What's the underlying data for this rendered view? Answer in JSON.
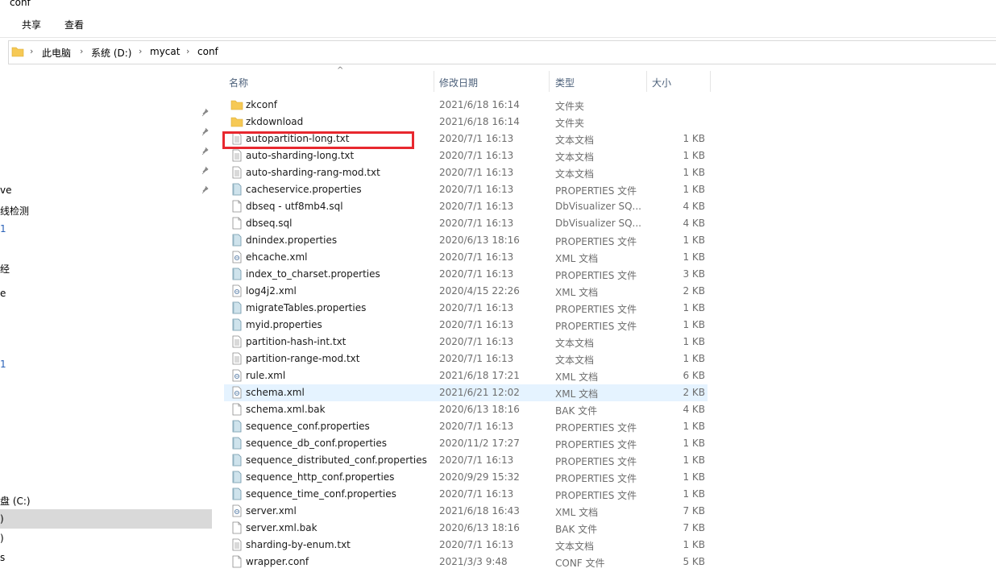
{
  "window": {
    "title": "conf"
  },
  "ribbon": {
    "tabs": [
      "共享",
      "查看"
    ]
  },
  "address": {
    "crumbs": [
      "此电脑",
      "系统 (D:)",
      "mycat",
      "conf"
    ]
  },
  "nav": {
    "items": [
      "ve",
      "线检测",
      "1",
      "经",
      "e",
      "1",
      "盘 (C:)",
      ")",
      ")",
      "s"
    ]
  },
  "columns": {
    "name": "名称",
    "date": "修改日期",
    "type": "类型",
    "size": "大小"
  },
  "files": [
    {
      "name": "zkconf",
      "date": "2021/6/18 16:14",
      "type": "文件夹",
      "size": "",
      "icon": "folder-icon"
    },
    {
      "name": "zkdownload",
      "date": "2021/6/18 16:14",
      "type": "文件夹",
      "size": "",
      "icon": "folder-icon"
    },
    {
      "name": "autopartition-long.txt",
      "date": "2020/7/1 16:13",
      "type": "文本文档",
      "size": "1 KB",
      "icon": "text-file-icon"
    },
    {
      "name": "auto-sharding-long.txt",
      "date": "2020/7/1 16:13",
      "type": "文本文档",
      "size": "1 KB",
      "icon": "text-file-icon"
    },
    {
      "name": "auto-sharding-rang-mod.txt",
      "date": "2020/7/1 16:13",
      "type": "文本文档",
      "size": "1 KB",
      "icon": "text-file-icon"
    },
    {
      "name": "cacheservice.properties",
      "date": "2020/7/1 16:13",
      "type": "PROPERTIES 文件",
      "size": "1 KB",
      "icon": "properties-file-icon"
    },
    {
      "name": "dbseq - utf8mb4.sql",
      "date": "2020/7/1 16:13",
      "type": "DbVisualizer SQ...",
      "size": "4 KB",
      "icon": "file-icon"
    },
    {
      "name": "dbseq.sql",
      "date": "2020/7/1 16:13",
      "type": "DbVisualizer SQ...",
      "size": "4 KB",
      "icon": "file-icon"
    },
    {
      "name": "dnindex.properties",
      "date": "2020/6/13 18:16",
      "type": "PROPERTIES 文件",
      "size": "1 KB",
      "icon": "properties-file-icon"
    },
    {
      "name": "ehcache.xml",
      "date": "2020/7/1 16:13",
      "type": "XML 文档",
      "size": "1 KB",
      "icon": "xml-file-icon"
    },
    {
      "name": "index_to_charset.properties",
      "date": "2020/7/1 16:13",
      "type": "PROPERTIES 文件",
      "size": "3 KB",
      "icon": "properties-file-icon"
    },
    {
      "name": "log4j2.xml",
      "date": "2020/4/15 22:26",
      "type": "XML 文档",
      "size": "2 KB",
      "icon": "xml-file-icon"
    },
    {
      "name": "migrateTables.properties",
      "date": "2020/7/1 16:13",
      "type": "PROPERTIES 文件",
      "size": "1 KB",
      "icon": "properties-file-icon"
    },
    {
      "name": "myid.properties",
      "date": "2020/7/1 16:13",
      "type": "PROPERTIES 文件",
      "size": "1 KB",
      "icon": "properties-file-icon"
    },
    {
      "name": "partition-hash-int.txt",
      "date": "2020/7/1 16:13",
      "type": "文本文档",
      "size": "1 KB",
      "icon": "text-file-icon"
    },
    {
      "name": "partition-range-mod.txt",
      "date": "2020/7/1 16:13",
      "type": "文本文档",
      "size": "1 KB",
      "icon": "text-file-icon"
    },
    {
      "name": "rule.xml",
      "date": "2021/6/18 17:21",
      "type": "XML 文档",
      "size": "6 KB",
      "icon": "xml-file-icon"
    },
    {
      "name": "schema.xml",
      "date": "2021/6/21 12:02",
      "type": "XML 文档",
      "size": "2 KB",
      "icon": "xml-file-icon",
      "selected": true
    },
    {
      "name": "schema.xml.bak",
      "date": "2020/6/13 18:16",
      "type": "BAK 文件",
      "size": "4 KB",
      "icon": "file-icon"
    },
    {
      "name": "sequence_conf.properties",
      "date": "2020/7/1 16:13",
      "type": "PROPERTIES 文件",
      "size": "1 KB",
      "icon": "properties-file-icon"
    },
    {
      "name": "sequence_db_conf.properties",
      "date": "2020/11/2 17:27",
      "type": "PROPERTIES 文件",
      "size": "1 KB",
      "icon": "properties-file-icon"
    },
    {
      "name": "sequence_distributed_conf.properties",
      "date": "2020/7/1 16:13",
      "type": "PROPERTIES 文件",
      "size": "1 KB",
      "icon": "properties-file-icon"
    },
    {
      "name": "sequence_http_conf.properties",
      "date": "2020/9/29 15:32",
      "type": "PROPERTIES 文件",
      "size": "1 KB",
      "icon": "properties-file-icon"
    },
    {
      "name": "sequence_time_conf.properties",
      "date": "2020/7/1 16:13",
      "type": "PROPERTIES 文件",
      "size": "1 KB",
      "icon": "properties-file-icon"
    },
    {
      "name": "server.xml",
      "date": "2021/6/18 16:43",
      "type": "XML 文档",
      "size": "7 KB",
      "icon": "xml-file-icon"
    },
    {
      "name": "server.xml.bak",
      "date": "2020/6/13 18:16",
      "type": "BAK 文件",
      "size": "7 KB",
      "icon": "file-icon"
    },
    {
      "name": "sharding-by-enum.txt",
      "date": "2020/7/1 16:13",
      "type": "文本文档",
      "size": "1 KB",
      "icon": "text-file-icon"
    },
    {
      "name": "wrapper.conf",
      "date": "2021/3/3 9:48",
      "type": "CONF 文件",
      "size": "5 KB",
      "icon": "file-icon"
    }
  ],
  "colors": {
    "highlight_box": "#e8282f",
    "selection": "#e5f3ff",
    "header_text": "#4c607a",
    "folder": "#f6c955"
  }
}
